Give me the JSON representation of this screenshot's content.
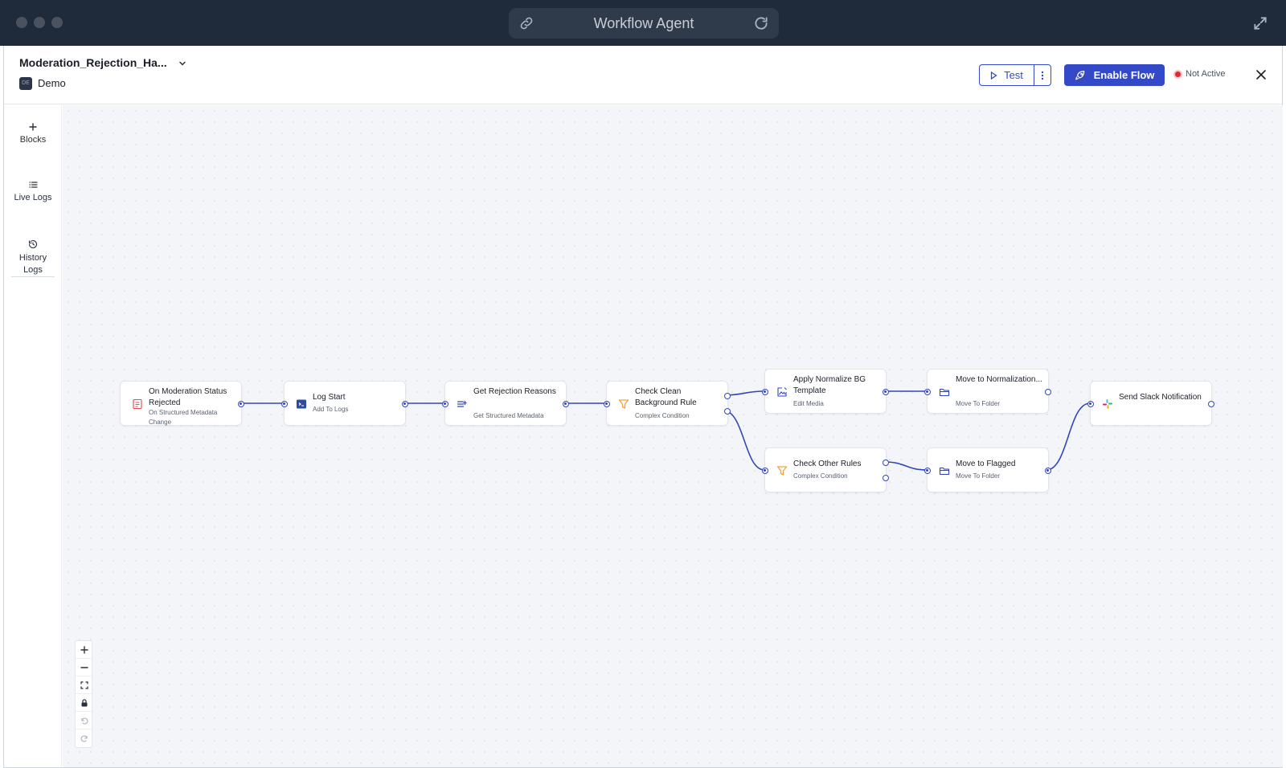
{
  "browser": {
    "title": "Workflow Agent"
  },
  "header": {
    "flow_name": "Moderation_Rejection_Ha...",
    "workspace_badge": "DE",
    "workspace_name": "Demo",
    "test_label": "Test",
    "enable_label": "Enable Flow",
    "status_label": "Not Active"
  },
  "sidebar": {
    "blocks_label": "Blocks",
    "live_logs_label": "Live Logs",
    "history_logs_line1": "History",
    "history_logs_line2": "Logs"
  },
  "nodes": [
    {
      "title": "On Moderation Status Rejected",
      "subtitle": "On Structured Metadata Change",
      "icon": "form-icon"
    },
    {
      "title": "Log Start",
      "subtitle": "Add To Logs",
      "icon": "terminal-icon"
    },
    {
      "title": "Get Rejection Reasons",
      "subtitle": "Get Structured Metadata",
      "icon": "list-icon"
    },
    {
      "title": "Check Clean Background Rule",
      "subtitle": "Complex Condition",
      "icon": "filter-icon"
    },
    {
      "title": "Apply Normalize BG Template",
      "subtitle": "Edit Media",
      "icon": "image-edit-icon"
    },
    {
      "title": "Move to Normalization...",
      "subtitle": "Move To Folder",
      "icon": "folder-icon"
    },
    {
      "title": "Check Other Rules",
      "subtitle": "Complex Condition",
      "icon": "filter-icon"
    },
    {
      "title": "Move to Flagged",
      "subtitle": "Move To Folder",
      "icon": "folder-icon"
    },
    {
      "title": "Send Slack Notification",
      "subtitle": "",
      "icon": "slack-icon"
    }
  ],
  "colors": {
    "accent": "#3349c8",
    "edge": "#3346b8",
    "titlebar": "#1f2a3a",
    "status_inactive": "#e0282e",
    "filter": "#f2a33a",
    "trigger": "#e5484d"
  }
}
